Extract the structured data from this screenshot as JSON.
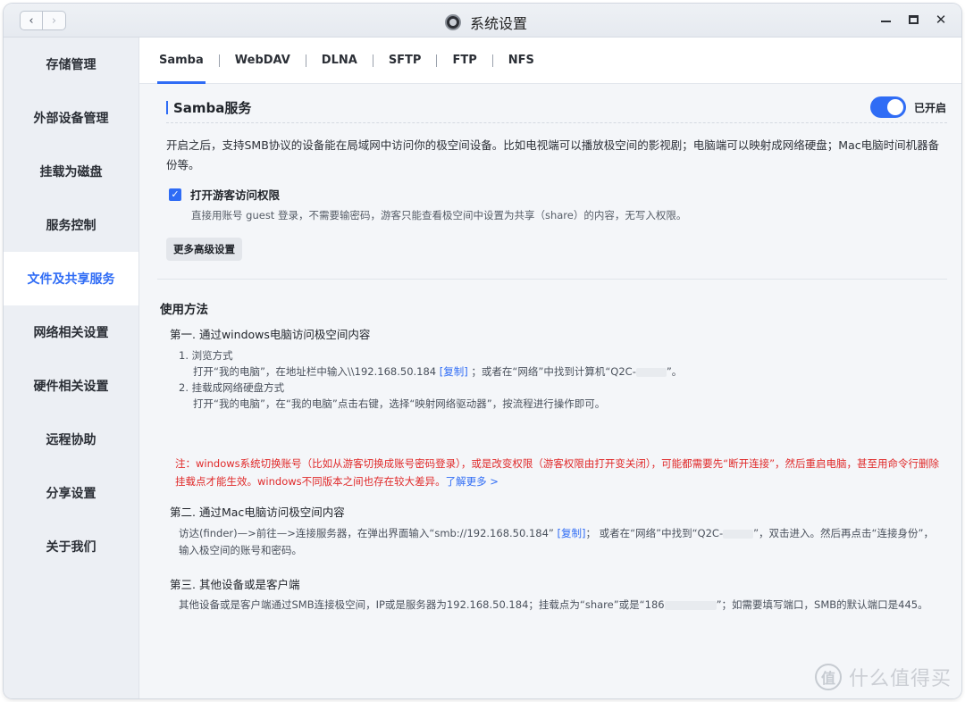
{
  "window": {
    "title": "系统设置"
  },
  "sidebar": {
    "items": [
      {
        "label": "存储管理"
      },
      {
        "label": "外部设备管理"
      },
      {
        "label": "挂载为磁盘"
      },
      {
        "label": "服务控制"
      },
      {
        "label": "文件及共享服务",
        "active": true
      },
      {
        "label": "网络相关设置"
      },
      {
        "label": "硬件相关设置"
      },
      {
        "label": "远程协助"
      },
      {
        "label": "分享设置"
      },
      {
        "label": "关于我们"
      }
    ]
  },
  "tabs": [
    "Samba",
    "WebDAV",
    "DLNA",
    "SFTP",
    "FTP",
    "NFS"
  ],
  "samba": {
    "title": "Samba服务",
    "toggle_on": true,
    "toggle_label": "已开启",
    "description": "开启之后，支持SMB协议的设备能在局域网中访问你的极空间设备。比如电视端可以播放极空间的影视剧；电脑端可以映射成网络硬盘；Mac电脑时间机器备份等。",
    "guest_checked": true,
    "guest_label": "打开游客访问权限",
    "guest_note": "直接用账号 guest 登录，不需要输密码，游客只能查看极空间中设置为共享（share）的内容，无写入权限。",
    "advanced_button": "更多高级设置"
  },
  "usage": {
    "title": "使用方法",
    "step1": {
      "title": "第一. 通过windows电脑访问极空间内容",
      "sub1_title": "1. 浏览方式",
      "sub1_a": "打开“我的电脑”，在地址栏中输入\\\\192.168.50.184",
      "sub1_copy": "[复制]",
      "sub1_b": "；或者在“网络”中找到计算机“Q2C-",
      "sub1_c": "”。",
      "sub2_title": "2. 挂载成网络硬盘方式",
      "sub2_text": "打开“我的电脑”，在“我的电脑”点击右键，选择“映射网络驱动器”，按流程进行操作即可。",
      "warning": "注：windows系统切换账号（比如从游客切换成账号密码登录），或是改变权限（游客权限由打开变关闭），可能都需要先“断开连接”，然后重启电脑，甚至用命令行删除挂载点才能生效。windows不同版本之间也存在较大差异。",
      "learn_more": "了解更多 >"
    },
    "step2": {
      "title": "第二. 通过Mac电脑访问极空间内容",
      "line1_a": "访达(finder)—>前往—>连接服务器，在弹出界面输入“smb://192.168.50.184”",
      "line1_copy": "[复制]",
      "line1_b": "；  或者在“网络”中找到“Q2C-",
      "line1_c": "”，双击进入。然后再点击“连接身份”，",
      "line2": "输入极空间的账号和密码。"
    },
    "step3": {
      "title": "第三. 其他设备或是客户端",
      "line_a": "其他设备或是客户端通过SMB连接极空间，IP或是服务器为192.168.50.184；挂载点为“share”或是“186",
      "line_b": "”；如需要填写端口，SMB的默认端口是445。"
    }
  },
  "watermark": {
    "icon": "值",
    "text": "什么值得买"
  }
}
